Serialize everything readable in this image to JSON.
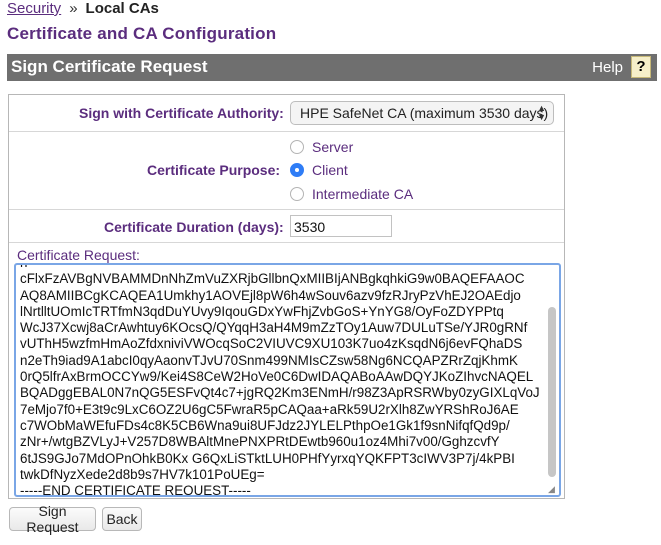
{
  "breadcrumb": {
    "parent": "Security",
    "separator": "»",
    "current": "Local CAs"
  },
  "page": {
    "title": "Certificate and CA Configuration"
  },
  "section": {
    "title": "Sign Certificate Request",
    "help_label": "Help",
    "help_icon": "?"
  },
  "form": {
    "authority_label": "Sign with Certificate Authority:",
    "authority_value": "HPE SafeNet CA (maximum 3530 days)",
    "purpose_label": "Certificate Purpose:",
    "purpose_options": [
      "Server",
      "Client",
      "Intermediate CA"
    ],
    "purpose_selected": "Client",
    "duration_label": "Certificate Duration (days):",
    "duration_value": "3530",
    "request_label": "Certificate Request:",
    "request_lines": [
      "h",
      "cFlxFzAVBgNVBAMMDnNhZmVuZXRjbGllbnQxMIIBIjANBgkqhkiG9w0BAQEFAAOC",
      "AQ8AMIIBCgKCAQEA1Umkhy1AOVEjl8pW6h4wSouv6azv9fzRJryPzVhEJ2OAEdjo",
      "lNrtlltUOmIcTRTfmN3qdDuYUvy9IqouGDxYwFhjZvbGoS+YnYG8/OyFoZDYPPtq",
      "WcJ37Xcwj8aCrAwhtuy6KOcsQ/QYqqH3aH4M9mZzTOy1Auw7DULuTSe/YJR0gRNf",
      "vUThH5wzfmHmAoZfdxniviVWOcqSoC2VIUVC9XU103K7uo4zKsqdN6j6evFQhaDS",
      "n2eTh9iad9A1abcI0qyAaonvTJvU70Snm499NMIsCZsw58Ng6NCQAPZRrZqjKhmK",
      "0rQ5lfrAxBrmOCCYw9/Kei4S8CeW2HoVe0C6DwIDAQABoAAwDQYJKoZIhvcNAQEL",
      "BQADggEBAL0N7nQG5ESFvQt4c7+jgRQ2Km3ENmH/r98Z3ApRSRWby0zyGIXLqVoJ",
      "7eMjo7f0+E3t9c9LxC6OZ2U6gC5FwraR5pCAQaa+aRk59U2rXlh8ZwYRShRoJ6AE",
      "c7WObMaWEfuFDs4c8K5CB6Wna9ui8UFJdz2JYLELPthpOe1Gk1f9snNifqfQd9p/",
      "zNr+/wtgBZVLyJ+V257D8WBAltMnePNXPRtDEwtb960u1oz4Mhi7v00/GghzcvfY",
      "6tJS9GJo7MdOPnOhkB0Kx G6QxLiSTktLUH0PHfYyrxqYQKFPT3cIWV3P7j/4kPBI",
      "twkDfNyzXede2d8b9s7HV7k101PoUEg=",
      "-----END CERTIFICATE REQUEST-----"
    ]
  },
  "buttons": {
    "sign": "Sign Request",
    "back": "Back"
  }
}
